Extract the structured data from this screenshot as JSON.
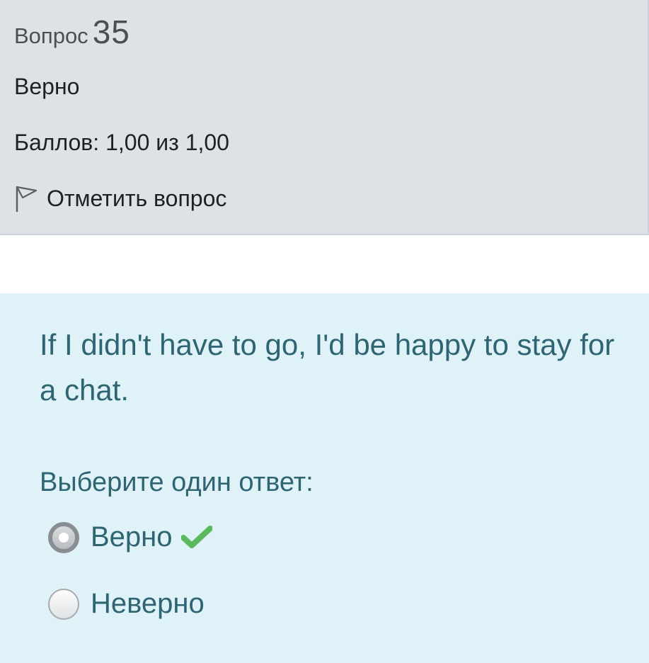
{
  "info": {
    "question_word": "Вопрос",
    "question_number": "35",
    "state": "Верно",
    "grade": "Баллов: 1,00 из 1,00",
    "flag_label": "Отметить вопрос",
    "flag_icon": "flag-outline-icon"
  },
  "question": {
    "text": "If I didn't have to go, I'd be happy to stay for a chat.",
    "prompt": "Выберите один ответ:",
    "answers": [
      {
        "label": "Верно",
        "selected": true,
        "correct_mark": "check-icon"
      },
      {
        "label": "Неверно",
        "selected": false
      }
    ]
  },
  "colors": {
    "info_bg": "#dee2e6",
    "content_bg": "#def2f8",
    "content_text": "#2f6473",
    "correct_check": "#5cb85c"
  }
}
